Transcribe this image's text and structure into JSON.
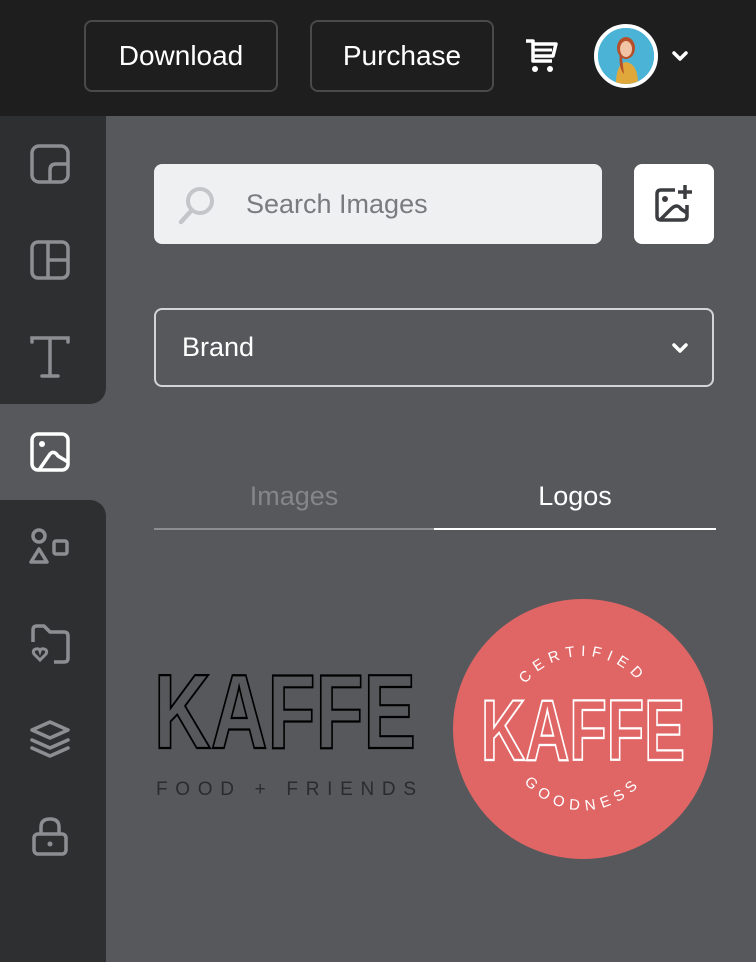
{
  "header": {
    "download_label": "Download",
    "purchase_label": "Purchase",
    "cart_icon": "cart-icon",
    "avatar_icon": "user-avatar",
    "menu_icon": "chevron-down-icon"
  },
  "sidebar": {
    "items": [
      {
        "name": "templates",
        "icon": "template-icon",
        "active": false
      },
      {
        "name": "layouts",
        "icon": "layout-icon",
        "active": false
      },
      {
        "name": "text",
        "icon": "text-icon",
        "active": false
      },
      {
        "name": "images",
        "icon": "image-icon",
        "active": true
      },
      {
        "name": "elements",
        "icon": "shapes-icon",
        "active": false
      },
      {
        "name": "favorites",
        "icon": "folder-heart-icon",
        "active": false
      },
      {
        "name": "layers",
        "icon": "layers-icon",
        "active": false
      },
      {
        "name": "lock",
        "icon": "lock-icon",
        "active": false
      }
    ]
  },
  "search": {
    "placeholder": "Search Images",
    "value": ""
  },
  "upload": {
    "icon": "image-add-icon"
  },
  "filter": {
    "selected": "Brand"
  },
  "tabs": [
    {
      "label": "Images",
      "active": false
    },
    {
      "label": "Logos",
      "active": true
    }
  ],
  "logos": [
    {
      "title": "KAFFE",
      "tagline": "FOOD + FRIENDS",
      "color": "#000000"
    },
    {
      "title": "KAFFE",
      "top_arc": "CERTIFIED",
      "bottom_arc": "GOODNESS",
      "color": "#e06666"
    }
  ],
  "colors": {
    "topbar": "#1e1e1e",
    "sidebar": "#2e2f31",
    "panel": "#57585c",
    "badge": "#e06666"
  }
}
